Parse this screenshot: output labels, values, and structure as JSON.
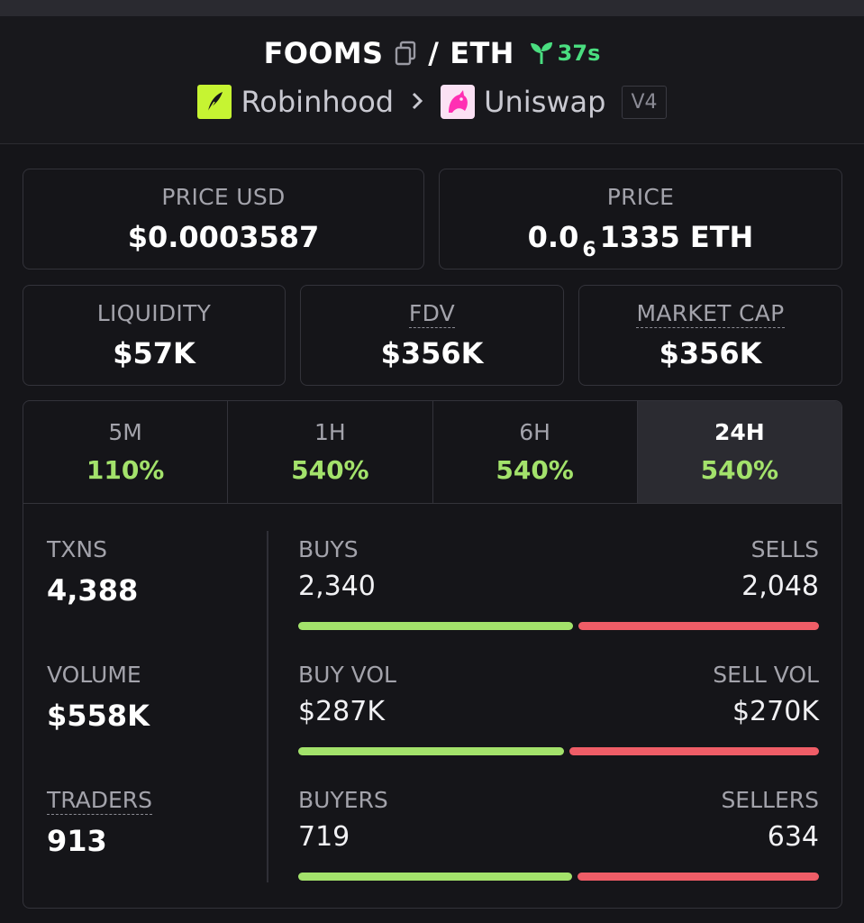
{
  "header": {
    "pair_base": "FOOMS",
    "pair_sep": "/",
    "pair_quote": "ETH",
    "age": "37s",
    "chain": "Robinhood",
    "dex": "Uniswap",
    "version": "V4"
  },
  "prices": {
    "price_usd_label": "PRICE USD",
    "price_usd": "$0.0003587",
    "price_label": "PRICE",
    "price_prefix": "0.0",
    "price_zeros": "6",
    "price_suffix": "1335 ETH"
  },
  "metrics": {
    "liquidity_label": "LIQUIDITY",
    "liquidity": "$57K",
    "fdv_label": "FDV",
    "fdv": "$356K",
    "mcap_label": "MARKET CAP",
    "mcap": "$356K"
  },
  "timeframes": [
    {
      "label": "5M",
      "change": "110%"
    },
    {
      "label": "1H",
      "change": "540%"
    },
    {
      "label": "6H",
      "change": "540%"
    },
    {
      "label": "24H",
      "change": "540%",
      "active": true
    }
  ],
  "stats": {
    "txns_label": "TXNS",
    "txns": "4,388",
    "volume_label": "VOLUME",
    "volume": "$558K",
    "traders_label": "TRADERS",
    "traders": "913"
  },
  "splits": {
    "buys_label": "BUYS",
    "buys": "2,340",
    "sells_label": "SELLS",
    "sells": "2,048",
    "buys_fraction": 0.533,
    "buyvol_label": "BUY VOL",
    "buyvol": "$287K",
    "sellvol_label": "SELL VOL",
    "sellvol": "$270K",
    "buyvol_fraction": 0.515,
    "buyers_label": "BUYERS",
    "buyers": "719",
    "sellers_label": "SELLERS",
    "sellers": "634",
    "buyers_fraction": 0.531
  },
  "colors": {
    "positive": "#a3e26b",
    "negative": "#ef5d67",
    "age_green": "#4ade80",
    "chain_brand": "#c6f432",
    "dex_brand": "#fbe1f4"
  },
  "icons": {
    "copy": "copy-icon",
    "age": "seedling-icon",
    "chain": "robinhood-feather-icon",
    "dex": "uniswap-unicorn-icon",
    "chevron": "chevron-right-icon"
  }
}
